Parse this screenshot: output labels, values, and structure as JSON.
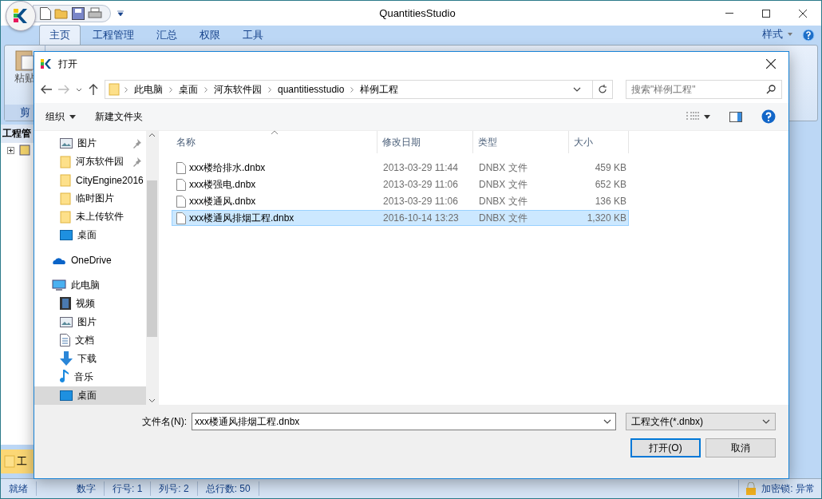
{
  "app": {
    "title": "QuantitiesStudio",
    "tabs": [
      {
        "label": "主页",
        "selected": true
      },
      {
        "label": "工程管理",
        "selected": false
      },
      {
        "label": "汇总",
        "selected": false
      },
      {
        "label": "权限",
        "selected": false
      },
      {
        "label": "工具",
        "selected": false
      }
    ],
    "style_menu": "样式",
    "ribbon": {
      "paste": "粘贴",
      "group": "剪"
    },
    "left_panel": {
      "title": "工程管"
    },
    "bottom_panel": {
      "title": "工"
    },
    "status_bar": [
      {
        "text": "就绪"
      },
      {
        "text": "数字"
      },
      {
        "text": "行号: 1"
      },
      {
        "text": "列号: 2"
      },
      {
        "text": "总行数: 50"
      }
    ],
    "lock": "加密锁: 异常"
  },
  "dialog": {
    "title": "打开",
    "breadcrumb": [
      "此电脑",
      "桌面",
      "河东软件园",
      "quantitiesstudio",
      "样例工程"
    ],
    "search": {
      "placeholder": "搜索\"样例工程\""
    },
    "toolbar": {
      "organize": "组织",
      "new_folder": "新建文件夹"
    },
    "nav": [
      {
        "kind": "pictures",
        "label": "图片",
        "pinned": true,
        "selected": false
      },
      {
        "kind": "folder",
        "label": "河东软件园",
        "pinned": true,
        "selected": false
      },
      {
        "kind": "folder",
        "label": "CityEngine2016",
        "pinned": false,
        "selected": false
      },
      {
        "kind": "folder",
        "label": "临时图片",
        "pinned": false,
        "selected": false
      },
      {
        "kind": "folder",
        "label": "未上传软件",
        "pinned": false,
        "selected": false
      },
      {
        "kind": "desktop",
        "label": "桌面",
        "pinned": false,
        "selected": false
      },
      {
        "kind": "cloud",
        "label": "OneDrive",
        "pinned": false,
        "selected": false
      },
      {
        "kind": "computer",
        "label": "此电脑",
        "pinned": false,
        "selected": false,
        "children": [
          {
            "kind": "video",
            "label": "视频",
            "pinned": false,
            "selected": false
          },
          {
            "kind": "pictures",
            "label": "图片",
            "pinned": false,
            "selected": false
          },
          {
            "kind": "document",
            "label": "文档",
            "pinned": false,
            "selected": false
          },
          {
            "kind": "download",
            "label": "下载",
            "pinned": false,
            "selected": false
          },
          {
            "kind": "music",
            "label": "音乐",
            "pinned": false,
            "selected": false
          },
          {
            "kind": "desktop",
            "label": "桌面",
            "pinned": false,
            "selected": true
          }
        ]
      }
    ],
    "columns": [
      "名称",
      "修改日期",
      "类型",
      "大小"
    ],
    "rows": [
      {
        "name": "xxx楼给排水.dnbx",
        "date": "2013-03-29 11:44",
        "type": "DNBX 文件",
        "size": "459 KB",
        "selected": false
      },
      {
        "name": "xxx楼强电.dnbx",
        "date": "2013-03-29 11:06",
        "type": "DNBX 文件",
        "size": "652 KB",
        "selected": false
      },
      {
        "name": "xxx楼通风.dnbx",
        "date": "2013-03-29 11:06",
        "type": "DNBX 文件",
        "size": "136 KB",
        "selected": false
      },
      {
        "name": "xxx楼通风排烟工程.dnbx",
        "date": "2016-10-14 13:23",
        "type": "DNBX 文件",
        "size": "1,320 KB",
        "selected": true
      }
    ],
    "filename_label": "文件名(N):",
    "filename": "xxx楼通风排烟工程.dnbx",
    "filter": "工程文件(*.dnbx)",
    "buttons": [
      "打开(O)",
      "取消"
    ]
  }
}
